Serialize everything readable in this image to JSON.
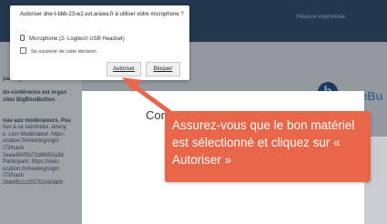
{
  "app": {
    "header_title": "Réunion improvisée",
    "chat_lines": [
      "participants.",
      "",
      "do-conférence est organ",
      "sitez BigBlueButton.",
      "",
      "",
      "nue aux modérateurs. Pas",
      "tion à ce séminaire, envoy",
      "s. Lien Modérateur :https:",
      "ucation.fr/meeting/signi",
      "/73/hash",
      "2eea460f5b72d6fb52a38",
      "Participant :https://visio",
      "ucation.fr/meeting/signi",
      "/73/hash",
      "2b6df5c1cf25752c60dd9"
    ],
    "logo_letter": "b",
    "side_text": "eBu",
    "modal_text": "Conn"
  },
  "permission": {
    "title": "Autoriser dne-t-bbb-23-w2.ext.arawa.fr à utiliser votre microphone ?",
    "device": "Microphone (2- Logitech USB Headset)",
    "remember": "Se souvenir de cette décision",
    "allow_label": "Autoriser",
    "block_label": "Bloquer"
  },
  "callout": {
    "text": "Assurez-vous que le bon matériel est sélectionné et cliquez sur « Autoriser »",
    "color": "#e8664a"
  }
}
